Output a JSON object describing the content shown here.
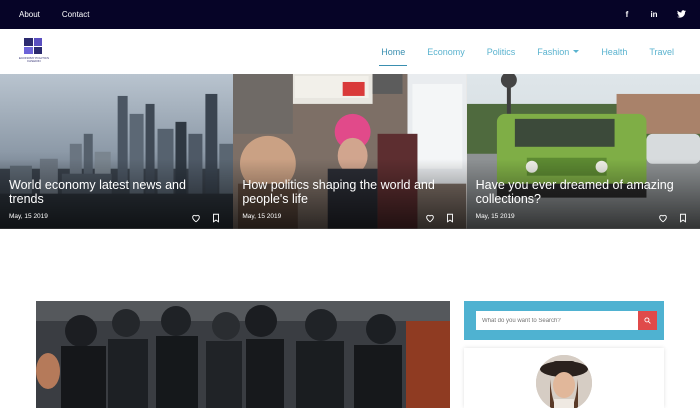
{
  "topbar": {
    "links": [
      "About",
      "Contact"
    ],
    "social": [
      {
        "icon": "facebook-icon",
        "glyph": "f"
      },
      {
        "icon": "linkedin-icon",
        "glyph": "in"
      },
      {
        "icon": "twitter-icon",
        "glyph": "t"
      }
    ]
  },
  "header": {
    "logo_text": "ECONOMY POLITICS FASHION",
    "nav": [
      "Home",
      "Economy",
      "Politics",
      "Fashion",
      "Health",
      "Travel"
    ],
    "active_nav": "Home"
  },
  "hero": {
    "cards": [
      {
        "title": "World economy latest news and trends",
        "date": "May, 15 2019"
      },
      {
        "title": "How politics shaping the world and people's life",
        "date": "May, 15 2019"
      },
      {
        "title": "Have you ever dreamed of amazing collections?",
        "date": "May, 15 2019"
      }
    ]
  },
  "sidebar": {
    "search_placeholder": "What do you want to Search?"
  },
  "colors": {
    "topbar_bg": "#060427",
    "nav_link": "#5ab3cf",
    "search_panel": "#4fb2d1",
    "search_button": "#e04a4a"
  }
}
